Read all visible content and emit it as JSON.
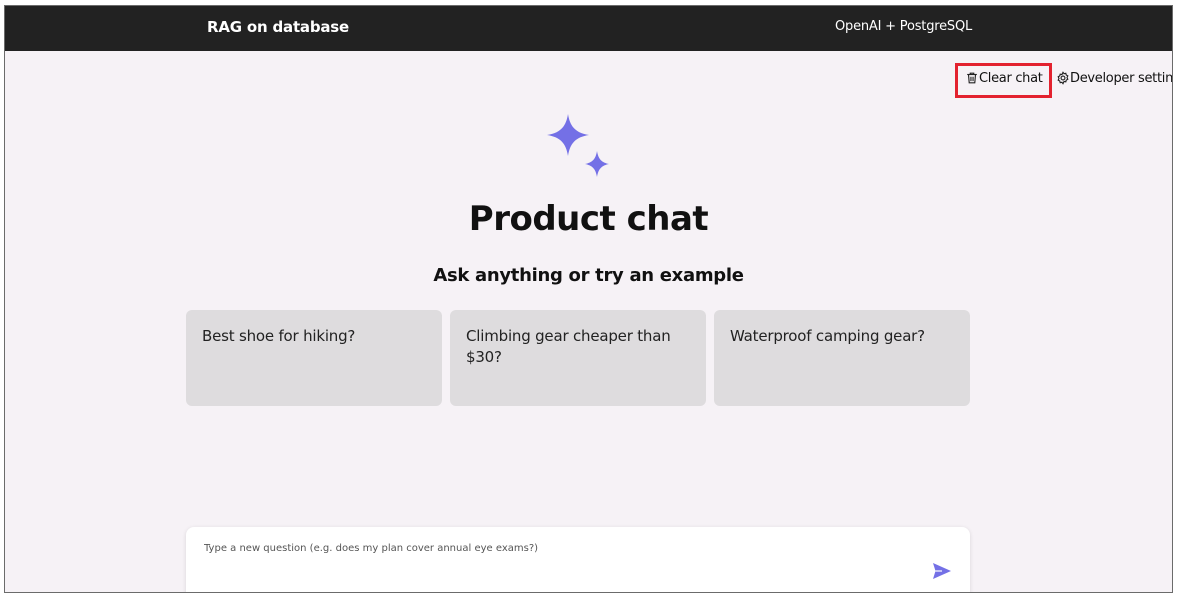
{
  "header": {
    "title": "RAG on database",
    "subtitle": "OpenAI + PostgreSQL"
  },
  "commands": {
    "clear_chat": "Clear chat",
    "developer_settings": "Developer settings"
  },
  "hero": {
    "title": "Product chat",
    "subtitle": "Ask anything or try an example",
    "icon": "sparkle-icon"
  },
  "examples": [
    {
      "text": "Best shoe for hiking?"
    },
    {
      "text": "Climbing gear cheaper than $30?"
    },
    {
      "text": "Waterproof camping gear?"
    }
  ],
  "question_input": {
    "placeholder": "Type a new question (e.g. does my plan cover annual eye exams?)",
    "value": ""
  },
  "icons": {
    "clear": "trash-icon",
    "settings": "gear-icon",
    "send": "send-icon"
  },
  "colors": {
    "header_bg": "#222222",
    "page_bg": "#f6f2f6",
    "accent": "#7470e6",
    "card_bg": "#dedcde",
    "highlight_border": "#e3222f"
  }
}
